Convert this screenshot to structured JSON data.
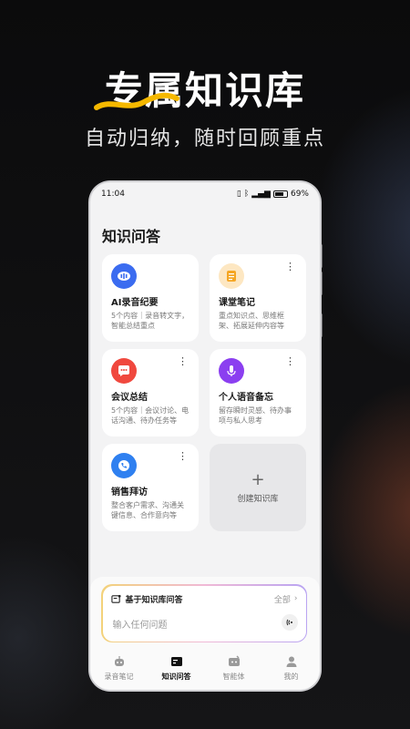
{
  "promo": {
    "headline": "专属知识库",
    "subhead": "自动归纳，随时回顾重点"
  },
  "status_bar": {
    "time": "11:04",
    "battery": "69%"
  },
  "page": {
    "title": "知识问答"
  },
  "cards": [
    {
      "title": "AI录音纪要",
      "desc": "5个内容｜录音转文字，智能总结重点",
      "icon": "ai-eye-icon",
      "color": "#3b6cf0"
    },
    {
      "title": "课堂笔记",
      "desc": "重点知识点、思维框架、拓展延伸内容等",
      "icon": "note-icon",
      "color": "#f5a623"
    },
    {
      "title": "会议总结",
      "desc": "5个内容｜会议讨论、电话沟通、待办任务等",
      "icon": "chat-bubble-icon",
      "color": "#f0483e"
    },
    {
      "title": "个人语音备忘",
      "desc": "留存瞬时灵感、待办事项与私人思考",
      "icon": "microphone-icon",
      "color": "#8b3ff0"
    },
    {
      "title": "销售拜访",
      "desc": "整合客户需求、沟通关键信息、合作意向等",
      "icon": "phone-icon",
      "color": "#2f80f0"
    }
  ],
  "create_card": {
    "plus": "+",
    "label": "创建知识库"
  },
  "ask": {
    "title": "基于知识库问答",
    "all": "全部",
    "placeholder": "输入任何问题"
  },
  "tabs": [
    {
      "label": "录音笔记",
      "icon": "robot-icon"
    },
    {
      "label": "知识问答",
      "icon": "knowledge-icon"
    },
    {
      "label": "智能体",
      "icon": "agent-icon"
    },
    {
      "label": "我的",
      "icon": "user-icon"
    }
  ]
}
